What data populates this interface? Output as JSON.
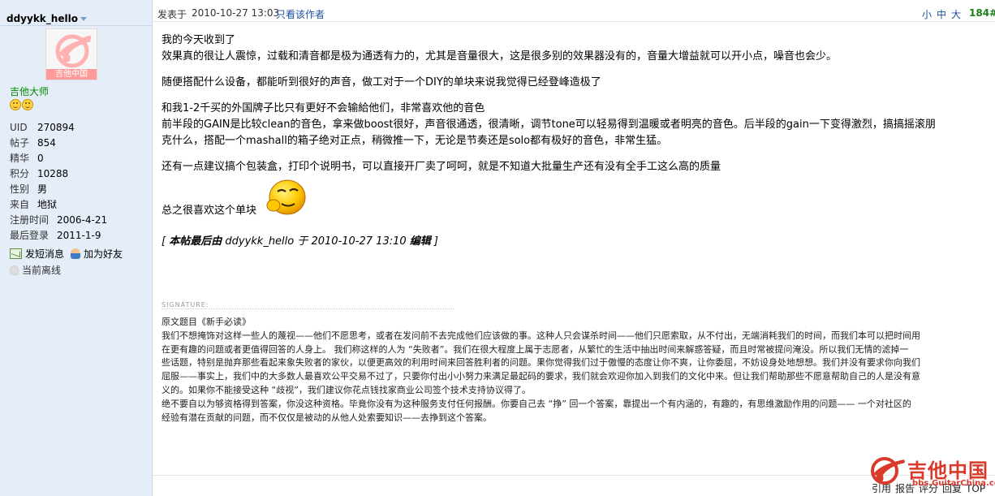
{
  "user": {
    "username": "ddyykk_hello",
    "avatar_caption": "吉他中国",
    "group": "吉他大师",
    "stats": [
      {
        "key": "UID",
        "value": "270894"
      },
      {
        "key": "帖子",
        "value": "854"
      },
      {
        "key": "精华",
        "value": "0"
      },
      {
        "key": "积分",
        "value": "10288"
      },
      {
        "key": "性别",
        "value": "男"
      },
      {
        "key": "来自",
        "value": "地狱"
      },
      {
        "key": "注册时间",
        "value": "2006-4-21"
      },
      {
        "key": "最后登录",
        "value": "2011-1-9"
      }
    ],
    "actions": {
      "send_message": "发短消息",
      "add_friend": "加为好友",
      "status": "当前离线"
    }
  },
  "post": {
    "posted_label": "发表于",
    "posted_time": "2010-10-27 13:03",
    "only_author": "只看该作者",
    "font_sizes": [
      "小",
      "中",
      "大"
    ],
    "floor": "184#",
    "paragraphs": [
      "我的今天收到了",
      "效果真的很让人震惊，过载和清音都是极为通透有力的，尤其是音量很大，这是很多别的效果器没有的，音量大增益就可以开小点，噪音也会少。",
      "随便搭配什么设备，都能听到很好的声音，做工对于一个DIY的单块来说我觉得已经登峰造极了",
      "和我1-2千买的外国牌子比只有更好不会输給他们，非常喜欢他的音色",
      "前半段的GAIN是比较clean的音色，拿来做boost很好，声音很通透，很清晰，调节tone可以轻易得到温暖或者明亮的音色。后半段的gain一下变得激烈，搞搞摇滚朋",
      "克什么，搭配一个mashall的箱子绝对正点，稍微推一下，无论是节奏还是solo都有极好的音色，非常生猛。",
      "还有一点建议搞个包装盒，打印个说明书，可以直接开厂卖了呵呵，就是不知道大批量生产还有没有全手工这么高的质量",
      "总之很喜欢这个单块"
    ],
    "edited_prefix": "[ ",
    "edited_text": "本帖最后由",
    "edited_by": " ddyykk_hello  于  2010-10-27 13:10 ",
    "edited_suffix": "编辑",
    "edited_end": " ]",
    "signature_label": "SIGNATURE:",
    "signature_title": "原文题目《新手必读》",
    "signature_lines": [
      "我们不想掩饰对这样一些人的蔑视——他们不愿思考，或者在发问前不去完成他们应该做的事。这种人只会谋杀时间——他们只愿索取，从不付出，无端消耗我们的时间，而我们本可以把时间用",
      "在更有趣的问题或者更值得回答的人身上。 我们称这样的人为 “失败者”。我们在很大程度上属于志愿者，从繁忙的生活中抽出时间来解惑答疑，而且时常被提问淹没。所以我们无情的滤掉一",
      "些话题，特别是抛弃那些看起来象失败者的家伙，以便更高效的利用时间来回答胜利者的问题。果你觉得我们过于傲慢的态度让你不爽，让你委屈，不妨设身处地想想。我们并没有要求你向我们",
      "屈服——事实上，我们中的大多数人最喜欢公平交易不过了，只要你付出小小努力来满足最起码的要求，我们就会欢迎你加入到我们的文化中来。但让我们帮助那些不愿意帮助自己的人是没有意",
      "义的。如果你不能接受这种 “歧视”，我们建议你花点钱找家商业公司签个技术支持协议得了。",
      "绝不要自以为够资格得到答案，你没这种资格。毕竟你没有为这种服务支付任何报酬。你要自己去 “挣” 回一个答案，靠提出一个有内涵的，有趣的，有思维激励作用的问题—— 一个对社区的",
      "经验有潜在贡献的问题，而不仅仅是被动的从他人处索要知识——去挣到这个答案。"
    ],
    "actions": [
      "引用",
      "报告",
      "评分",
      "回复",
      "TOP"
    ]
  },
  "watermark": {
    "text": "吉他中国",
    "url_text": "bbs.GuitarChina.com"
  },
  "colors": {
    "sidebar_bg": "#e5eef8",
    "link_blue": "#1a4fa3",
    "group_green": "#008a00",
    "floor_green": "#1a7f1a",
    "watermark_red": "#d93a2b"
  }
}
